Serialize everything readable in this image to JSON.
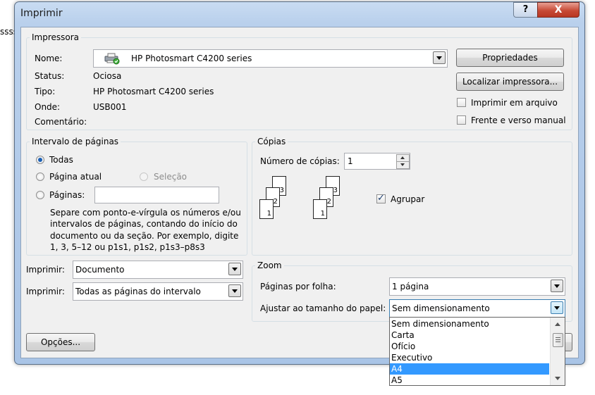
{
  "background_fragment": "sssss",
  "window": {
    "title": "Imprimir",
    "help_label": "?",
    "close_label": "X"
  },
  "printer": {
    "group_label": "Impressora",
    "name_label": "Nome:",
    "name_value": "HP Photosmart C4200 series",
    "status_label": "Status:",
    "status_value": "Ociosa",
    "type_label": "Tipo:",
    "type_value": "HP Photosmart C4200 series",
    "where_label": "Onde:",
    "where_value": "USB001",
    "comment_label": "Comentário:",
    "comment_value": "",
    "properties_button": "Propriedades",
    "find_printer_button": "Localizar impressora...",
    "print_to_file_label": "Imprimir em arquivo",
    "print_to_file_checked": false,
    "manual_duplex_label": "Frente e verso manual",
    "manual_duplex_checked": false
  },
  "range": {
    "group_label": "Intervalo de páginas",
    "all_label": "Todas",
    "current_label": "Página atual",
    "selection_label": "Seleção",
    "pages_label": "Páginas:",
    "pages_value": "",
    "selected": "all",
    "hint_lines": [
      "Separe com ponto-e-vírgula os números e/ou",
      "intervalos de páginas, contando do início do",
      "documento ou da seção. Por exemplo, digite",
      "1, 3, 5–12 ou p1s1, p1s2, p1s3–p8s3"
    ]
  },
  "copies": {
    "group_label": "Cópias",
    "count_label": "Número de cópias:",
    "count_value": "1",
    "collate_label": "Agrupar",
    "collate_checked": true,
    "page_numbers": [
      "1",
      "2",
      "3"
    ]
  },
  "print_what": {
    "label": "Imprimir:",
    "value": "Documento"
  },
  "print_range": {
    "label": "Imprimir:",
    "value": "Todas as páginas do intervalo"
  },
  "zoom": {
    "group_label": "Zoom",
    "pages_per_sheet_label": "Páginas por folha:",
    "pages_per_sheet_value": "1 página",
    "scale_label": "Ajustar ao tamanho do papel:",
    "scale_value": "Sem dimensionamento",
    "options": [
      "Sem dimensionamento",
      "Carta",
      "Ofício",
      "Executivo",
      "A4",
      "A5"
    ],
    "highlighted_option": "A4"
  },
  "options_button": "Opções..."
}
